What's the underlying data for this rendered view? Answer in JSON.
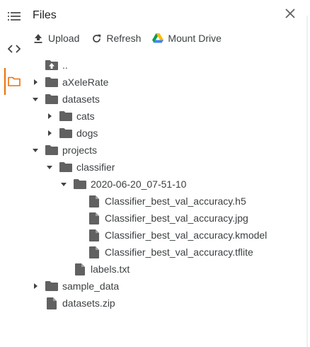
{
  "header": {
    "title": "Files"
  },
  "toolbar": {
    "upload_label": "Upload",
    "refresh_label": "Refresh",
    "mount_drive_label": "Mount Drive"
  },
  "tree": [
    {
      "label": "..",
      "type": "up",
      "depth": 0,
      "expanded": null
    },
    {
      "label": "aXeleRate",
      "type": "folder",
      "depth": 0,
      "expanded": false
    },
    {
      "label": "datasets",
      "type": "folder",
      "depth": 0,
      "expanded": true
    },
    {
      "label": "cats",
      "type": "folder",
      "depth": 1,
      "expanded": false
    },
    {
      "label": "dogs",
      "type": "folder",
      "depth": 1,
      "expanded": false
    },
    {
      "label": "projects",
      "type": "folder",
      "depth": 0,
      "expanded": true
    },
    {
      "label": "classifier",
      "type": "folder",
      "depth": 1,
      "expanded": true
    },
    {
      "label": "2020-06-20_07-51-10",
      "type": "folder",
      "depth": 2,
      "expanded": true
    },
    {
      "label": "Classifier_best_val_accuracy.h5",
      "type": "file",
      "depth": 3,
      "expanded": null
    },
    {
      "label": "Classifier_best_val_accuracy.jpg",
      "type": "file",
      "depth": 3,
      "expanded": null
    },
    {
      "label": "Classifier_best_val_accuracy.kmodel",
      "type": "file",
      "depth": 3,
      "expanded": null
    },
    {
      "label": "Classifier_best_val_accuracy.tflite",
      "type": "file",
      "depth": 3,
      "expanded": null
    },
    {
      "label": "labels.txt",
      "type": "file",
      "depth": 2,
      "expanded": null
    },
    {
      "label": "sample_data",
      "type": "folder",
      "depth": 0,
      "expanded": false
    },
    {
      "label": "datasets.zip",
      "type": "file",
      "depth": 0,
      "expanded": null
    }
  ],
  "icons": {
    "menu": "menu-icon",
    "code": "code-icon",
    "folder_panel": "folder-panel-icon",
    "close": "close-icon",
    "upload": "upload-icon",
    "refresh": "refresh-icon",
    "drive": "google-drive-icon"
  },
  "colors": {
    "accent": "#e8710a",
    "icon_gray": "#616161",
    "text": "#3c4043"
  }
}
